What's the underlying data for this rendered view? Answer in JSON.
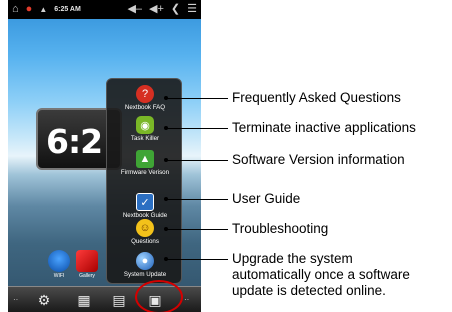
{
  "status_bar": {
    "time": "6:25 AM",
    "icons": [
      "home-icon",
      "notification-icon",
      "wifi-icon",
      "volume-down-icon",
      "volume-up-icon",
      "back-icon",
      "menu-icon"
    ]
  },
  "home": {
    "clock_time": "6:2",
    "apps": [
      {
        "label": "WIFI",
        "icon": "wifi-icon"
      },
      {
        "label": "Gallery",
        "icon": "gallery-icon"
      }
    ]
  },
  "menu": {
    "items": [
      {
        "label": "Nextbook FAQ",
        "icon": "faq-icon",
        "color": "#d62f22"
      },
      {
        "label": "Task Killer",
        "icon": "android-icon",
        "color": "#7ab727"
      },
      {
        "label": "Firmware Verison",
        "icon": "firmware-icon",
        "color": "#3fa535"
      },
      {
        "label": "Nextbook Guide",
        "icon": "guide-icon",
        "color": "#2b6fc2"
      },
      {
        "label": "Questions",
        "icon": "questions-icon",
        "color": "#f3c21a"
      },
      {
        "label": "System Update",
        "icon": "update-icon",
        "color": "#2f7fd6"
      }
    ]
  },
  "dock": {
    "buttons": [
      "settings-icon",
      "app-drawer-icon",
      "book-icon",
      "nextbook-menu-icon"
    ],
    "ellipsis": "··"
  },
  "callouts": [
    {
      "text": "Frequently Asked Questions"
    },
    {
      "text": "Terminate inactive applications"
    },
    {
      "text": "Software Version information"
    },
    {
      "text": "User Guide"
    },
    {
      "text": "Troubleshooting"
    },
    {
      "text": "Upgrade the system"
    },
    {
      "text": "automatically once a software"
    },
    {
      "text": "update is detected online."
    }
  ],
  "colors": {
    "highlight_circle": "#d40000"
  }
}
